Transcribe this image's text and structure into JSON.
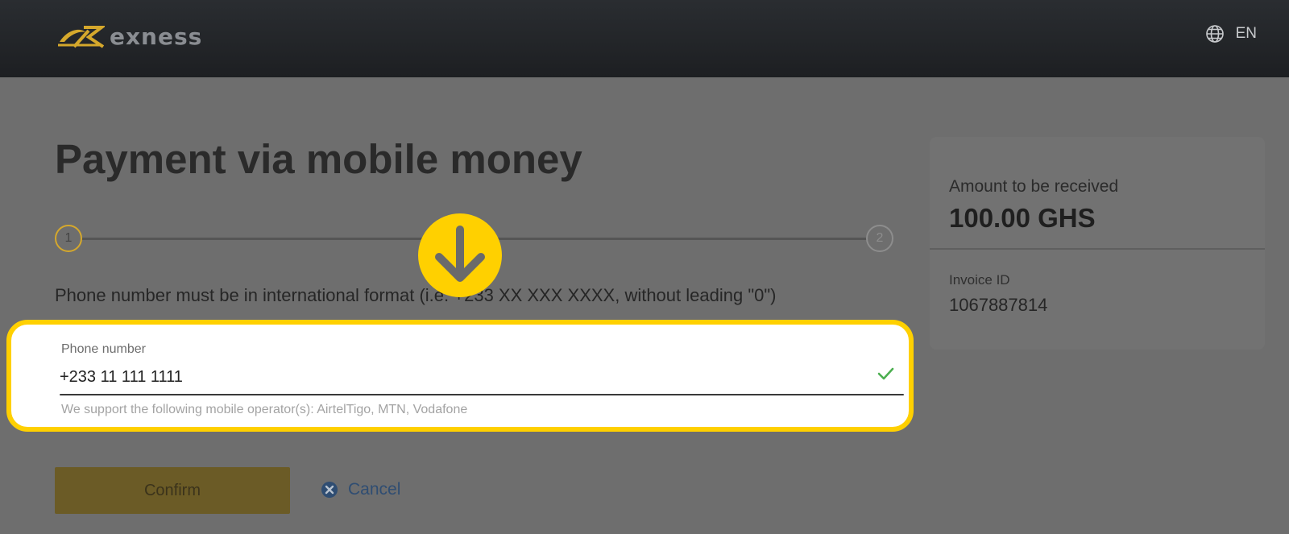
{
  "header": {
    "brand": "exness",
    "logo_icon": "exness-logo-icon",
    "language": "EN",
    "language_icon": "globe-icon"
  },
  "main": {
    "title": "Payment via mobile money",
    "steps": [
      {
        "number": "1",
        "state": "active"
      },
      {
        "number": "2",
        "state": "pending"
      }
    ],
    "hint": "Phone number must be in international format (i.e. +233 XX XXX XXXX, without leading \"0\")",
    "phone_field": {
      "label": "Phone number",
      "value": "+233 11 111 1111",
      "valid_icon": "checkmark-icon",
      "help": "We support the following mobile operator(s): AirtelTigo, MTN, Vodafone"
    },
    "overlay_icon": "arrow-down-icon",
    "confirm_label": "Confirm",
    "cancel_label": "Cancel",
    "cancel_icon": "close-circle-icon"
  },
  "summary": {
    "amount_label": "Amount to be received",
    "amount_value": "100.00 GHS",
    "invoice_label": "Invoice ID",
    "invoice_value": "1067887814"
  },
  "colors": {
    "highlight": "#ffd000",
    "accent_gold": "#d5a82c",
    "confirm_button": "#6b5b26",
    "cancel_link": "#2f4d72",
    "valid_check": "#4caf50"
  }
}
